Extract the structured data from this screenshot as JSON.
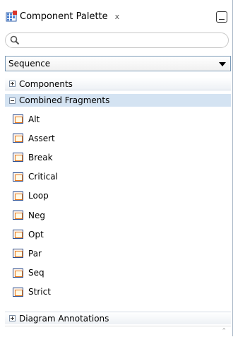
{
  "panel": {
    "title": "Component Palette",
    "close_glyph": "x"
  },
  "search": {
    "placeholder": "",
    "value": ""
  },
  "selector": {
    "value": "Sequence"
  },
  "sections": {
    "components": {
      "label": "Components",
      "expanded": false
    },
    "fragments": {
      "label": "Combined Fragments",
      "expanded": true
    },
    "annotations": {
      "label": "Diagram Annotations",
      "expanded": false
    }
  },
  "fragments": [
    {
      "label": "Alt"
    },
    {
      "label": "Assert"
    },
    {
      "label": "Break"
    },
    {
      "label": "Critical"
    },
    {
      "label": "Loop"
    },
    {
      "label": "Neg"
    },
    {
      "label": "Opt"
    },
    {
      "label": "Par"
    },
    {
      "label": "Seq"
    },
    {
      "label": "Strict"
    }
  ],
  "colors": {
    "selected_section": "#d4e3f2",
    "icon_accent": "#e67a1f",
    "icon_border": "#2f4f8f"
  },
  "icons": {
    "app": "component-palette-icon",
    "search": "search-icon",
    "dropdown": "chevron-down-icon",
    "expand": "plus-box-icon",
    "collapse": "minus-box-icon",
    "fragment": "combined-fragment-icon"
  }
}
